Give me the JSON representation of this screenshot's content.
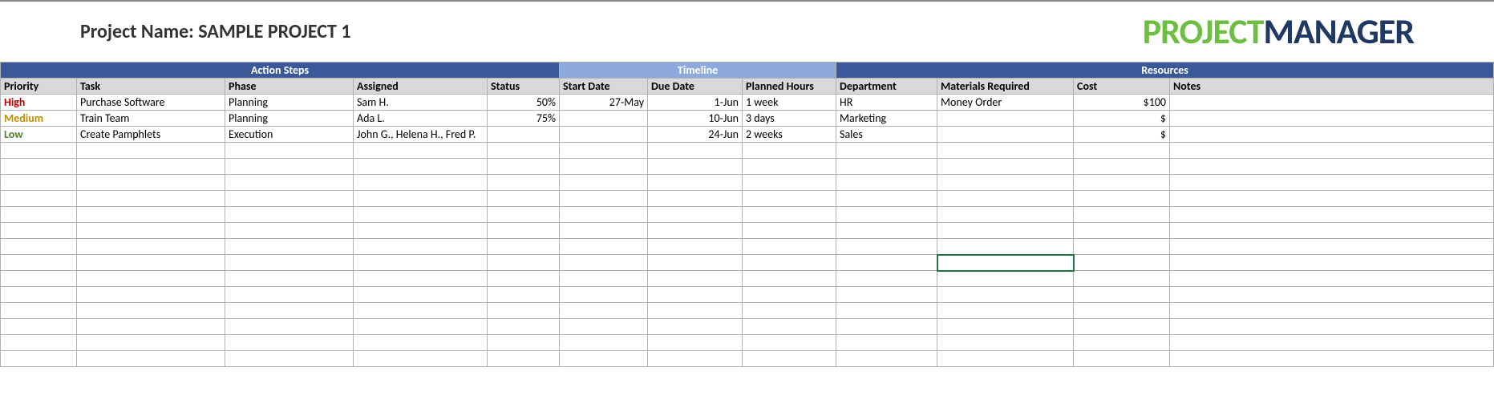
{
  "header": {
    "project_label": "Project Name: SAMPLE PROJECT 1",
    "logo_left": "PROJECT",
    "logo_right": "MANAGER"
  },
  "groups": {
    "action_steps": "Action Steps",
    "timeline": "Timeline",
    "resources": "Resources"
  },
  "columns": {
    "priority": "Priority",
    "task": "Task",
    "phase": "Phase",
    "assigned": "Assigned",
    "status": "Status",
    "start_date": "Start Date",
    "due_date": "Due Date",
    "planned_hours": "Planned Hours",
    "department": "Department",
    "materials": "Materials Required",
    "cost": "Cost",
    "notes": "Notes"
  },
  "rows": [
    {
      "priority": "High",
      "priority_level": "high",
      "task": "Purchase Software",
      "phase": "Planning",
      "assigned": "Sam H.",
      "status": "50%",
      "start_date": "27-May",
      "due_date": "1-Jun",
      "planned_hours": "1 week",
      "department": "HR",
      "materials": "Money Order",
      "cost": "$100",
      "notes": ""
    },
    {
      "priority": "Medium",
      "priority_level": "medium",
      "task": "Train Team",
      "phase": "Planning",
      "assigned": "Ada L.",
      "status": "75%",
      "start_date": "",
      "due_date": "10-Jun",
      "planned_hours": "3 days",
      "department": "Marketing",
      "materials": "",
      "cost": "$",
      "notes": ""
    },
    {
      "priority": "Low",
      "priority_level": "low",
      "task": "Create Pamphlets",
      "phase": "Execution",
      "assigned": "John G., Helena H., Fred P.",
      "status": "",
      "start_date": "",
      "due_date": "24-Jun",
      "planned_hours": "2 weeks",
      "department": "Sales",
      "materials": "",
      "cost": "$",
      "notes": ""
    }
  ],
  "empty_rows": 14,
  "selected_cell": {
    "row_index": 10,
    "col_index": 9
  }
}
